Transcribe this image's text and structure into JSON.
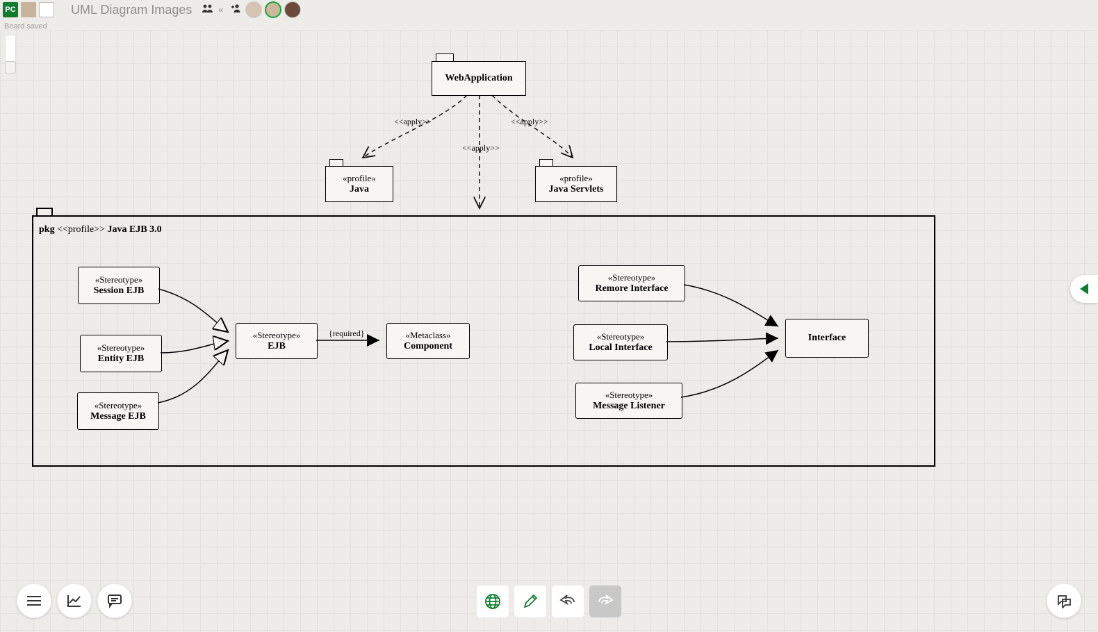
{
  "header": {
    "badge": "PC",
    "title": "UML Diagram Images",
    "saved": "Board saved"
  },
  "diagram": {
    "webapp": {
      "name": "WebApplication"
    },
    "java": {
      "stereo": "«profile»",
      "name": "Java"
    },
    "servlets": {
      "stereo": "«profile»",
      "name": "Java Servlets"
    },
    "apply1": "<<apply>>",
    "apply2": "<<apply>>",
    "apply3": "<<apply>>",
    "frame": {
      "kw": "pkg",
      "stereo": "<<profile>>",
      "name": "Java EJB 3.0"
    },
    "sessionEjb": {
      "stereo": "«Stereotype»",
      "name": "Session EJB"
    },
    "entityEjb": {
      "stereo": "«Stereotype»",
      "name": "Entity EJB"
    },
    "messageEjb": {
      "stereo": "«Stereotype»",
      "name": "Message EJB"
    },
    "ejb": {
      "stereo": "«Stereotype»",
      "name": "EJB"
    },
    "component": {
      "stereo": "«Metaclass»",
      "name": "Component"
    },
    "required": "{required}",
    "remote": {
      "stereo": "«Stereotype»",
      "name": "Remore Interface"
    },
    "local": {
      "stereo": "«Stereotype»",
      "name": "Local Interface"
    },
    "listener": {
      "stereo": "«Stereotype»",
      "name": "Message Listener"
    },
    "interface": {
      "name": "Interface"
    }
  }
}
